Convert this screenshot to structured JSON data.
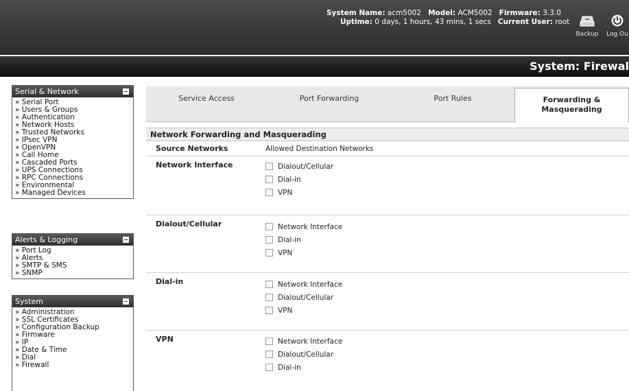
{
  "header": {
    "sysinfo": {
      "system_name_label": "System Name:",
      "system_name": "acm5002",
      "model_label": "Model:",
      "model": "ACM5002",
      "firmware_label": "Firmware:",
      "firmware": "3.3.0",
      "uptime_label": "Uptime:",
      "uptime": "0 days, 1 hours, 43 mins, 1 secs",
      "user_label": "Current User:",
      "user": "root"
    },
    "backup_label": "Backup",
    "logout_label": "Log Ou",
    "page_title": "System: Firewal"
  },
  "sidebar": {
    "serial_network": {
      "title": "Serial & Network",
      "items": [
        "Serial Port",
        "Users & Groups",
        "Authentication",
        "Network Hosts",
        "Trusted Networks",
        "IPsec VPN",
        "OpenVPN",
        "Call Home",
        "Cascaded Ports",
        "UPS Connections",
        "RPC Connections",
        "Environmental",
        "Managed Devices"
      ]
    },
    "alerts": {
      "title": "Alerts & Logging",
      "items": [
        "Port Log",
        "Alerts",
        "SMTP & SMS",
        "SNMP"
      ]
    },
    "system": {
      "title": "System",
      "items": [
        "Administration",
        "SSL Certificates",
        "Configuration Backup",
        "Firmware",
        "IP",
        "Date & Time",
        "Dial",
        "Firewall"
      ]
    }
  },
  "tabs": {
    "service_access": "Service Access",
    "port_forwarding": "Port Forwarding",
    "port_rules": "Port Rules",
    "fwd_masq_line1": "Forwarding &",
    "fwd_masq_line2": "Masquerading"
  },
  "content": {
    "section_title": "Network Forwarding and Masquerading",
    "col_source": "Source Networks",
    "col_dest": "Allowed Destination Networks",
    "rows": [
      {
        "label": "Network Interface",
        "options": [
          "Dialout/Cellular",
          "Dial-in",
          "VPN"
        ]
      },
      {
        "label": "Dialout/Cellular",
        "options": [
          "Network Interface",
          "Dial-in",
          "VPN"
        ]
      },
      {
        "label": "Dial-in",
        "options": [
          "Network Interface",
          "Dialout/Cellular",
          "VPN"
        ]
      },
      {
        "label": "VPN",
        "options": [
          "Network Interface",
          "Dialout/Cellular",
          "Dial-in"
        ]
      }
    ]
  }
}
